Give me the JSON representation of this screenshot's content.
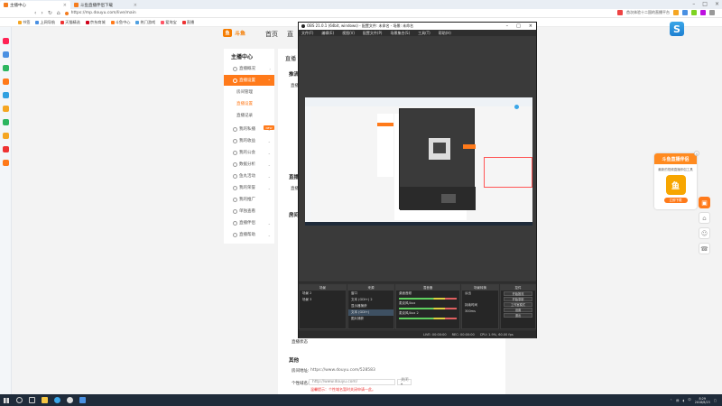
{
  "browser": {
    "tabs": [
      {
        "label": "主播中心"
      },
      {
        "label": "斗鱼直播伴侣下载"
      }
    ],
    "url": "https://mp.douyu.com/live/main",
    "toolbar_text": "首次体验十二国的直播平台",
    "bookmarks": [
      "书签",
      "上网导航",
      "天猫精选",
      "京东商城",
      "斗鱼中心",
      "热门游戏",
      "爱淘宝",
      "直播"
    ]
  },
  "douyu": {
    "brand": "斗鱼",
    "logo": "鱼",
    "nav": [
      "首页",
      "直"
    ],
    "menu_title": "主播中心",
    "menu": [
      {
        "label": "直播概况"
      },
      {
        "label": "直播设置"
      },
      {
        "label": "房间管理"
      },
      {
        "label": "直播设置"
      },
      {
        "label": "直播记录"
      },
      {
        "label": "我的私播"
      },
      {
        "label": "我的收益"
      },
      {
        "label": "我的公会"
      },
      {
        "label": "数据分析"
      },
      {
        "label": "鱼丸活动"
      },
      {
        "label": "我的荣誉"
      },
      {
        "label": "我的推广"
      },
      {
        "label": "单独查看"
      },
      {
        "label": "直播伴侣"
      },
      {
        "label": "直播帮助"
      }
    ],
    "new_badge": "NEW",
    "content": {
      "title": "直播",
      "section1": "推流",
      "section2": "直播",
      "section3": "房间",
      "section_other": "其他",
      "row_label_a": "直播",
      "row_label_b": "直播设置",
      "share_label": "房间地址:",
      "share_url": "https://www.douyu.com/528583",
      "custom_label": "个性域名:",
      "custom_value": "http://www.douyu.com/",
      "custom_btn": "关闭 ▾",
      "custom_warn": "温馨提示：个性域名暂时关闭申请一此。",
      "status_label": "直播状态"
    },
    "promo": {
      "title": "斗鱼直播伴侣",
      "text": "最新的视频直播伴侣工具",
      "logo": "鱼",
      "button": "立即下载"
    }
  },
  "obs": {
    "title": "OBS 21.0.1 (64bit, windows) - 配置文件: 未命名 - 场景: 未命名",
    "menu": [
      "文件(F)",
      "编辑(E)",
      "视图(V)",
      "配置文件(P)",
      "场景集合(S)",
      "工具(T)",
      "帮助(H)"
    ],
    "docks": {
      "scenes": {
        "title": "场景",
        "items": [
          "场景 2",
          "场景 3"
        ]
      },
      "sources": {
        "title": "来源",
        "items": [
          "窗口",
          "文本 (GDI+) 2",
          "显示器捕获",
          "文本 (GDI+)",
          "图片捕获"
        ]
      },
      "mixer": {
        "title": "混音器",
        "items": [
          "桌面音频",
          "麦克风/Aux",
          "麦克风/Aux 2"
        ]
      },
      "transitions": {
        "title": "场景转换",
        "type": "淡出",
        "duration_label": "持续时间",
        "duration": "300ms"
      },
      "controls": {
        "title": "控件",
        "buttons": [
          "开始推流",
          "开始录制",
          "工作室模式",
          "设置",
          "退出"
        ]
      }
    },
    "status": {
      "live": "LIVE: 00:00:00",
      "rec": "REC: 00:00:00",
      "cpu": "CPU: 1.9%, 60.00 fps"
    }
  },
  "taskbar": {
    "time": "8:29",
    "date": "2018/8/23",
    "lang": "中"
  },
  "colors": {
    "accent": "#ff7a1a",
    "obs_bg": "#2b2b2b"
  }
}
